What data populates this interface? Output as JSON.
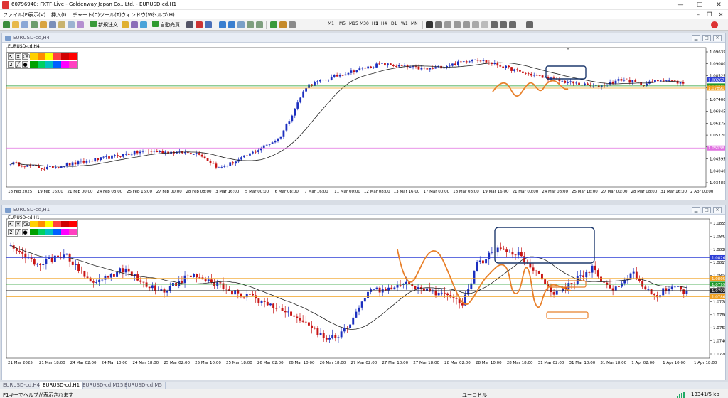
{
  "app": {
    "title": "60796940: FXTF-Live - Goldenway Japan Co., Ltd. - EURUSD-cd,H1",
    "window_controls": [
      "—",
      "□",
      "✕"
    ]
  },
  "menu": {
    "items": [
      "ファイル(F)",
      "表示(V)",
      "挿入(I)",
      "チャート(C)",
      "ツール(T)",
      "ウィンドウ(W)",
      "ヘルプ(H)"
    ]
  },
  "toolbar": {
    "new_order": "新規注文",
    "auto_trade": "自動売買",
    "timeframes": [
      "M1",
      "M5",
      "M15",
      "M30",
      "H1",
      "H4",
      "D1",
      "W1",
      "MN"
    ],
    "active_timeframe": "H1"
  },
  "colors": {
    "bull": "#1c2fbf",
    "bear": "#c81414",
    "ma": "#222222",
    "level_blue": "#2e3fd6",
    "level_green": "#1f9a2a",
    "level_orange": "#f0a020",
    "level_pink": "#e070e0",
    "drawing_orange": "#e8802a",
    "drawing_navy": "#1f3a6e"
  },
  "charts": [
    {
      "id": "h4",
      "window_title": "EURUSD-cd,H4",
      "symbol_label": "EURUSD-cd,H4",
      "price_ticks": [
        "1.09635",
        "1.09080",
        "1.08525",
        "1.07955",
        "1.07400",
        "1.06845",
        "1.06275",
        "1.05720",
        "1.05165",
        "1.04595",
        "1.04040",
        "1.03485"
      ],
      "price_range": [
        1.0335,
        1.0975
      ],
      "level_labels": [
        {
          "value": 1.08267,
          "text": "1.08267",
          "color": "#2e3fd6"
        },
        {
          "value": 1.0799,
          "text": "1.07990",
          "color": "#1f9a2a"
        },
        {
          "value": 1.0789,
          "text": "1.07890",
          "color": "#f0a020"
        },
        {
          "value": 1.05138,
          "text": "1.05138",
          "color": "#e070e0"
        }
      ],
      "time_labels": [
        "18 Feb 2025",
        "19 Feb 16:00",
        "21 Feb 00:00",
        "24 Feb 08:00",
        "25 Feb 16:00",
        "27 Feb 00:00",
        "28 Feb 08:00",
        "3 Mar 16:00",
        "5 Mar 00:00",
        "6 Mar 08:00",
        "7 Mar 16:00",
        "11 Mar 00:00",
        "12 Mar 08:00",
        "13 Mar 16:00",
        "17 Mar 00:00",
        "18 Mar 08:00",
        "19 Mar 16:00",
        "21 Mar 00:00",
        "24 Mar 08:00",
        "25 Mar 16:00",
        "27 Mar 00:00",
        "28 Mar 08:00",
        "31 Mar 16:00",
        "2 Apr 00:00"
      ]
    },
    {
      "id": "h1",
      "window_title": "EURUSD-cd,H1",
      "symbol_label": "EURUSD-cd,H1",
      "price_ticks": [
        "1.08555",
        "1.08430",
        "1.08300",
        "1.08170",
        "1.08045",
        "1.07915",
        "1.07785",
        "1.07660",
        "1.07530",
        "1.07400",
        "1.07280"
      ],
      "price_range": [
        1.0722,
        1.0867
      ],
      "level_labels": [
        {
          "value": 1.08267,
          "text": "1.08267",
          "color": "#2e3fd6"
        },
        {
          "value": 1.0805,
          "text": "1.08050",
          "color": "#f0a020"
        },
        {
          "value": 1.0799,
          "text": "1.07990",
          "color": "#1f9a2a"
        },
        {
          "value": 1.07924,
          "text": "1.07924",
          "color": "#222222"
        },
        {
          "value": 1.0786,
          "text": "1.07860",
          "color": "#f0a020"
        }
      ],
      "time_labels": [
        "21 Mar 2025",
        "21 Mar 18:00",
        "24 Mar 02:00",
        "24 Mar 10:00",
        "24 Mar 18:00",
        "25 Mar 02:00",
        "25 Mar 10:00",
        "25 Mar 18:00",
        "26 Mar 02:00",
        "26 Mar 10:00",
        "26 Mar 18:00",
        "27 Mar 02:00",
        "27 Mar 10:00",
        "27 Mar 18:00",
        "28 Mar 02:00",
        "28 Mar 10:00",
        "28 Mar 18:00",
        "31 Mar 02:00",
        "31 Mar 10:00",
        "31 Mar 18:00",
        "1 Apr 02:00",
        "1 Apr 10:00",
        "1 Apr 18:00"
      ]
    }
  ],
  "chart_tabs": [
    "EURUSD-cd,H4",
    "EURUSD-cd,H1",
    "EURUSD-cd,M15",
    "EURUSD-cd,M5"
  ],
  "active_tab": "EURUSD-cd,H1",
  "status": {
    "help": "F1キーでヘルプが表示されます",
    "profile": "ユーロドル",
    "traffic": "13341/5 kb"
  }
}
